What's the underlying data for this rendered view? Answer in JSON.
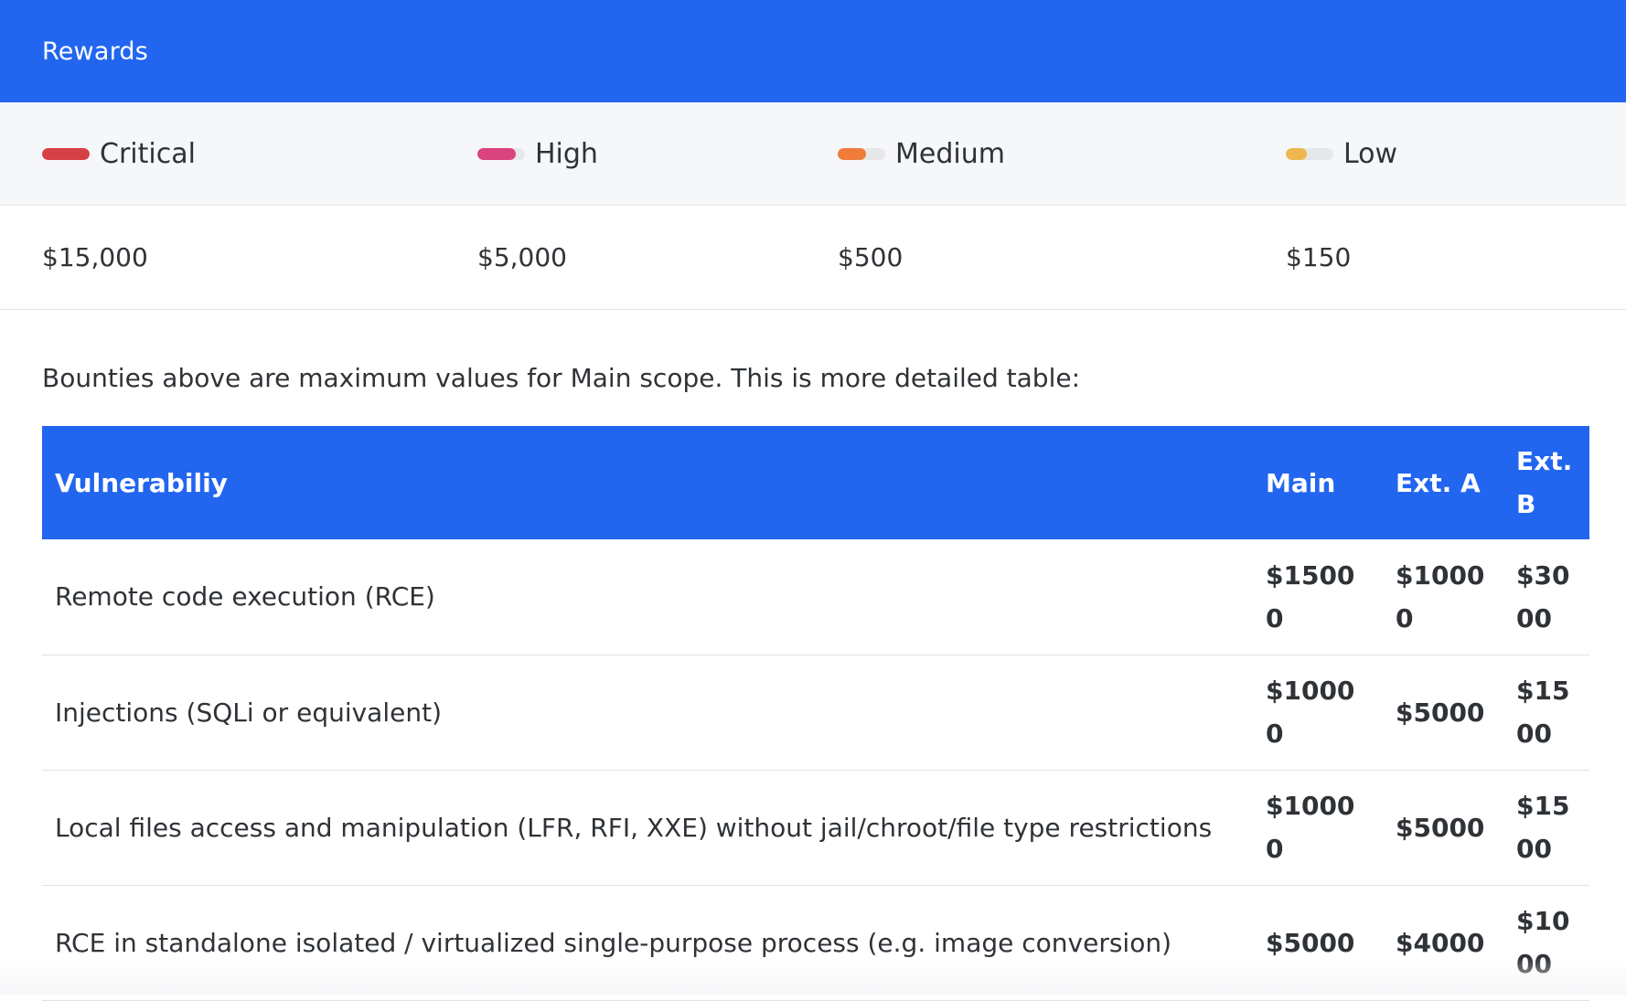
{
  "header": {
    "title": "Rewards"
  },
  "severities": [
    {
      "label": "Critical",
      "value": "$15,000",
      "color": "#d64045",
      "level": 1.0,
      "icon": "severity-bar-icon"
    },
    {
      "label": "High",
      "value": "$5,000",
      "color": "#d9437e",
      "level": 0.8,
      "icon": "severity-bar-icon"
    },
    {
      "label": "Medium",
      "value": "$500",
      "color": "#f07c3a",
      "level": 0.6,
      "icon": "severity-bar-icon"
    },
    {
      "label": "Low",
      "value": "$150",
      "color": "#ecb84f",
      "level": 0.45,
      "icon": "severity-bar-icon"
    }
  ],
  "note": "Bounties above are maximum values for Main scope. This is more detailed table:",
  "table": {
    "headers": [
      "Vulnerabiliy",
      "Main",
      "Ext. A",
      "Ext. B"
    ],
    "rows": [
      [
        "Remote code execution (RCE)",
        "$15000",
        "$10000",
        "$3000"
      ],
      [
        "Injections (SQLi or equivalent)",
        "$10000",
        "$5000",
        "$1500"
      ],
      [
        "Local files access and manipulation (LFR, RFI, XXE) without jail/chroot/file type restrictions",
        "$10000",
        "$5000",
        "$1500"
      ],
      [
        "RCE in standalone isolated / virtualized single-purpose process (e.g. image conversion)",
        "$5000",
        "$4000",
        "$1000"
      ]
    ]
  },
  "colors": {
    "accent": "#2266f0"
  }
}
